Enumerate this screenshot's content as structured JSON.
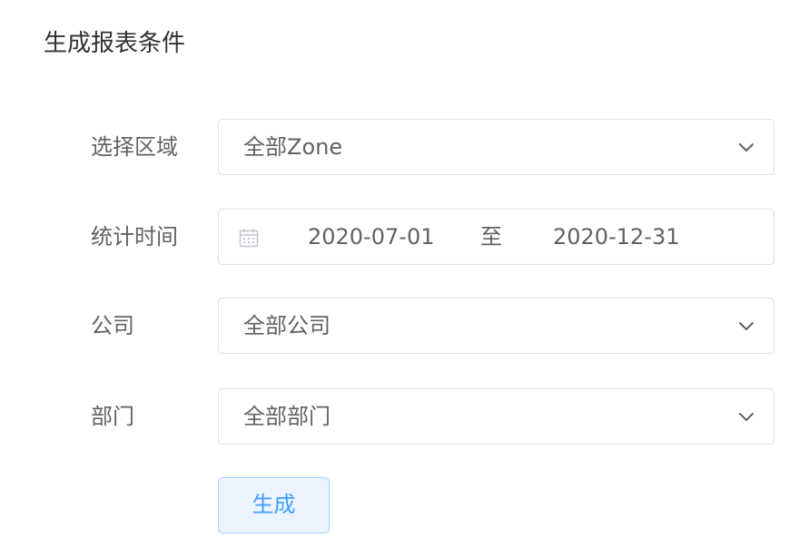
{
  "page": {
    "title": "生成报表条件"
  },
  "form": {
    "zone": {
      "label": "选择区域",
      "value": "全部Zone",
      "icon": "chevron-down-icon"
    },
    "period": {
      "label": "统计时间",
      "icon": "calendar-icon",
      "start": "2020-07-01",
      "separator": "至",
      "end": "2020-12-31"
    },
    "company": {
      "label": "公司",
      "value": "全部公司",
      "icon": "chevron-down-icon"
    },
    "department": {
      "label": "部门",
      "value": "全部部门",
      "icon": "chevron-down-icon"
    },
    "submit": {
      "label": "生成"
    }
  },
  "colors": {
    "border": "#dcdfe6",
    "text": "#606266",
    "title": "#303133",
    "primary": "#409eff",
    "primary_light_bg": "#ecf5ff",
    "primary_light_border": "#a3d0fd",
    "icon": "#c0c4cc"
  }
}
